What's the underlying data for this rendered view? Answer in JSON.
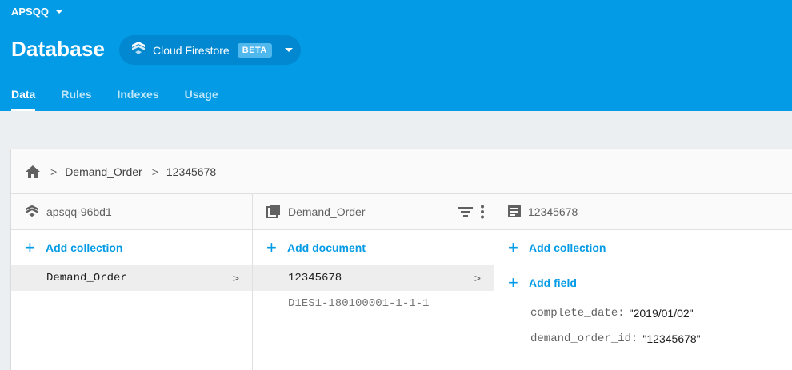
{
  "header": {
    "project_name": "APSQQ",
    "title": "Database",
    "product": {
      "name": "Cloud Firestore",
      "badge": "BETA"
    },
    "tabs": [
      {
        "label": "Data",
        "active": true
      },
      {
        "label": "Rules",
        "active": false
      },
      {
        "label": "Indexes",
        "active": false
      },
      {
        "label": "Usage",
        "active": false
      }
    ]
  },
  "breadcrumb": {
    "home_icon": "home-icon",
    "items": [
      "Demand_Order",
      "12345678"
    ]
  },
  "columns": {
    "root": {
      "title": "apsqq-96bd1",
      "icon": "firestore-icon",
      "add_label": "Add collection",
      "items": [
        {
          "label": "Demand_Order",
          "selected": true
        }
      ]
    },
    "collection": {
      "title": "Demand_Order",
      "icon": "collection-icon",
      "add_label": "Add document",
      "items": [
        {
          "label": "12345678",
          "selected": true
        },
        {
          "label": "D1ES1-180100001-1-1-1",
          "selected": false
        }
      ]
    },
    "document": {
      "title": "12345678",
      "icon": "document-icon",
      "add_collection_label": "Add collection",
      "add_field_label": "Add field",
      "fields": [
        {
          "key": "complete_date:",
          "value": "\"2019/01/02\""
        },
        {
          "key": "demand_order_id:",
          "value": "\"12345678\""
        }
      ]
    }
  },
  "colors": {
    "header_bg": "#039be5",
    "accent": "#039be5",
    "page_bg": "#eceff1"
  }
}
